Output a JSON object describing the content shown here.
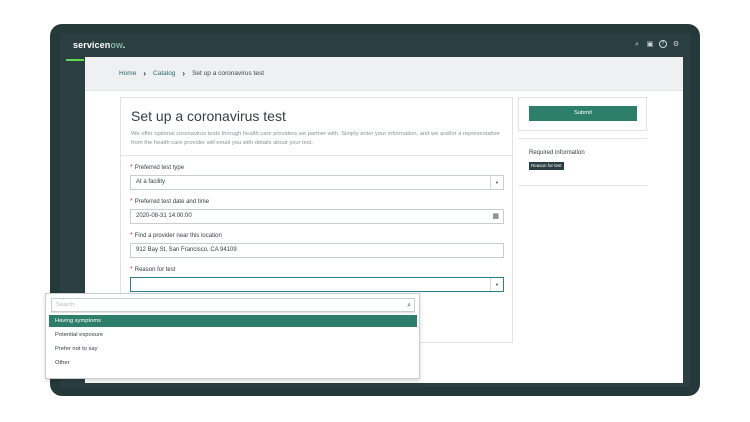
{
  "app": {
    "logo_main": "servicen",
    "logo_accent": "ow",
    "logo_dot": "."
  },
  "topbar_icons": [
    "search-icon",
    "chat-icon",
    "help-icon",
    "settings-icon"
  ],
  "breadcrumb": {
    "items": [
      "Home",
      "Catalog",
      "Set up a coronavirus test"
    ]
  },
  "form": {
    "title": "Set up a coronavirus test",
    "description": "We offer optional coronavirus tests through health care providers we partner with. Simply enter your information, and we and/or a representative from the health care provider will email you with details about your test.",
    "fields": [
      {
        "label": "Preferred test type",
        "value": "At a facility",
        "required": true
      },
      {
        "label": "Preferred test date and time",
        "value": "2020-08-31 14:00:00",
        "required": true
      },
      {
        "label": "Find a provider near this location",
        "value": "912 Bay St, San Francisco, CA 94109",
        "required": true
      },
      {
        "label": "Reason for test",
        "value": "",
        "required": true
      }
    ]
  },
  "dropdown": {
    "search_placeholder": "Search",
    "options": [
      "Having symptoms",
      "Potential exposure",
      "Prefer not to say",
      "Other"
    ],
    "selected": "Having symptoms"
  },
  "sidebar": {
    "submit_label": "Submit",
    "required_title": "Required information",
    "required_items": [
      "Reason for test"
    ]
  },
  "colors": {
    "accent": "#2d7f6b",
    "frame": "#25383a",
    "header": "#2b3e41",
    "required": "#c83c3c"
  }
}
